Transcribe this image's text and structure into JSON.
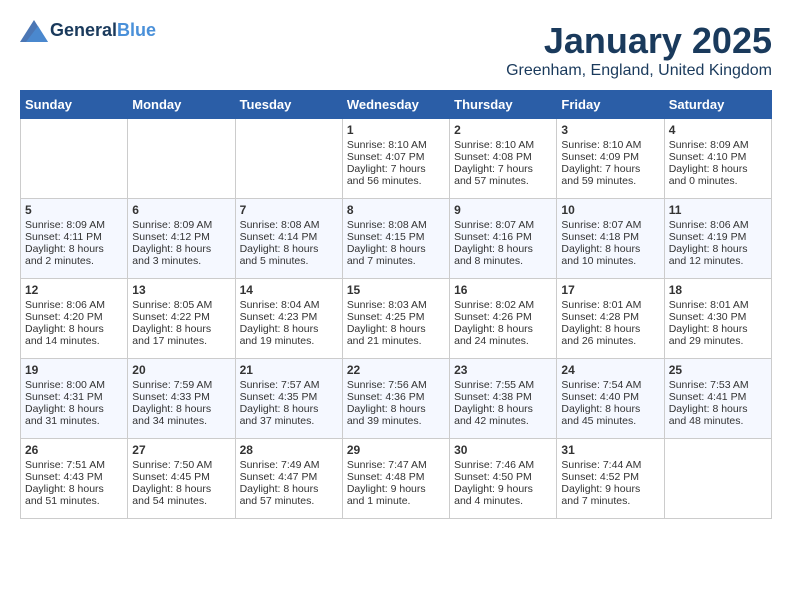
{
  "header": {
    "logo_line1": "General",
    "logo_line2": "Blue",
    "month_title": "January 2025",
    "location": "Greenham, England, United Kingdom"
  },
  "weekdays": [
    "Sunday",
    "Monday",
    "Tuesday",
    "Wednesday",
    "Thursday",
    "Friday",
    "Saturday"
  ],
  "weeks": [
    [
      {
        "num": "",
        "sunrise": "",
        "sunset": "",
        "daylight": ""
      },
      {
        "num": "",
        "sunrise": "",
        "sunset": "",
        "daylight": ""
      },
      {
        "num": "",
        "sunrise": "",
        "sunset": "",
        "daylight": ""
      },
      {
        "num": "1",
        "sunrise": "Sunrise: 8:10 AM",
        "sunset": "Sunset: 4:07 PM",
        "daylight": "Daylight: 7 hours and 56 minutes."
      },
      {
        "num": "2",
        "sunrise": "Sunrise: 8:10 AM",
        "sunset": "Sunset: 4:08 PM",
        "daylight": "Daylight: 7 hours and 57 minutes."
      },
      {
        "num": "3",
        "sunrise": "Sunrise: 8:10 AM",
        "sunset": "Sunset: 4:09 PM",
        "daylight": "Daylight: 7 hours and 59 minutes."
      },
      {
        "num": "4",
        "sunrise": "Sunrise: 8:09 AM",
        "sunset": "Sunset: 4:10 PM",
        "daylight": "Daylight: 8 hours and 0 minutes."
      }
    ],
    [
      {
        "num": "5",
        "sunrise": "Sunrise: 8:09 AM",
        "sunset": "Sunset: 4:11 PM",
        "daylight": "Daylight: 8 hours and 2 minutes."
      },
      {
        "num": "6",
        "sunrise": "Sunrise: 8:09 AM",
        "sunset": "Sunset: 4:12 PM",
        "daylight": "Daylight: 8 hours and 3 minutes."
      },
      {
        "num": "7",
        "sunrise": "Sunrise: 8:08 AM",
        "sunset": "Sunset: 4:14 PM",
        "daylight": "Daylight: 8 hours and 5 minutes."
      },
      {
        "num": "8",
        "sunrise": "Sunrise: 8:08 AM",
        "sunset": "Sunset: 4:15 PM",
        "daylight": "Daylight: 8 hours and 7 minutes."
      },
      {
        "num": "9",
        "sunrise": "Sunrise: 8:07 AM",
        "sunset": "Sunset: 4:16 PM",
        "daylight": "Daylight: 8 hours and 8 minutes."
      },
      {
        "num": "10",
        "sunrise": "Sunrise: 8:07 AM",
        "sunset": "Sunset: 4:18 PM",
        "daylight": "Daylight: 8 hours and 10 minutes."
      },
      {
        "num": "11",
        "sunrise": "Sunrise: 8:06 AM",
        "sunset": "Sunset: 4:19 PM",
        "daylight": "Daylight: 8 hours and 12 minutes."
      }
    ],
    [
      {
        "num": "12",
        "sunrise": "Sunrise: 8:06 AM",
        "sunset": "Sunset: 4:20 PM",
        "daylight": "Daylight: 8 hours and 14 minutes."
      },
      {
        "num": "13",
        "sunrise": "Sunrise: 8:05 AM",
        "sunset": "Sunset: 4:22 PM",
        "daylight": "Daylight: 8 hours and 17 minutes."
      },
      {
        "num": "14",
        "sunrise": "Sunrise: 8:04 AM",
        "sunset": "Sunset: 4:23 PM",
        "daylight": "Daylight: 8 hours and 19 minutes."
      },
      {
        "num": "15",
        "sunrise": "Sunrise: 8:03 AM",
        "sunset": "Sunset: 4:25 PM",
        "daylight": "Daylight: 8 hours and 21 minutes."
      },
      {
        "num": "16",
        "sunrise": "Sunrise: 8:02 AM",
        "sunset": "Sunset: 4:26 PM",
        "daylight": "Daylight: 8 hours and 24 minutes."
      },
      {
        "num": "17",
        "sunrise": "Sunrise: 8:01 AM",
        "sunset": "Sunset: 4:28 PM",
        "daylight": "Daylight: 8 hours and 26 minutes."
      },
      {
        "num": "18",
        "sunrise": "Sunrise: 8:01 AM",
        "sunset": "Sunset: 4:30 PM",
        "daylight": "Daylight: 8 hours and 29 minutes."
      }
    ],
    [
      {
        "num": "19",
        "sunrise": "Sunrise: 8:00 AM",
        "sunset": "Sunset: 4:31 PM",
        "daylight": "Daylight: 8 hours and 31 minutes."
      },
      {
        "num": "20",
        "sunrise": "Sunrise: 7:59 AM",
        "sunset": "Sunset: 4:33 PM",
        "daylight": "Daylight: 8 hours and 34 minutes."
      },
      {
        "num": "21",
        "sunrise": "Sunrise: 7:57 AM",
        "sunset": "Sunset: 4:35 PM",
        "daylight": "Daylight: 8 hours and 37 minutes."
      },
      {
        "num": "22",
        "sunrise": "Sunrise: 7:56 AM",
        "sunset": "Sunset: 4:36 PM",
        "daylight": "Daylight: 8 hours and 39 minutes."
      },
      {
        "num": "23",
        "sunrise": "Sunrise: 7:55 AM",
        "sunset": "Sunset: 4:38 PM",
        "daylight": "Daylight: 8 hours and 42 minutes."
      },
      {
        "num": "24",
        "sunrise": "Sunrise: 7:54 AM",
        "sunset": "Sunset: 4:40 PM",
        "daylight": "Daylight: 8 hours and 45 minutes."
      },
      {
        "num": "25",
        "sunrise": "Sunrise: 7:53 AM",
        "sunset": "Sunset: 4:41 PM",
        "daylight": "Daylight: 8 hours and 48 minutes."
      }
    ],
    [
      {
        "num": "26",
        "sunrise": "Sunrise: 7:51 AM",
        "sunset": "Sunset: 4:43 PM",
        "daylight": "Daylight: 8 hours and 51 minutes."
      },
      {
        "num": "27",
        "sunrise": "Sunrise: 7:50 AM",
        "sunset": "Sunset: 4:45 PM",
        "daylight": "Daylight: 8 hours and 54 minutes."
      },
      {
        "num": "28",
        "sunrise": "Sunrise: 7:49 AM",
        "sunset": "Sunset: 4:47 PM",
        "daylight": "Daylight: 8 hours and 57 minutes."
      },
      {
        "num": "29",
        "sunrise": "Sunrise: 7:47 AM",
        "sunset": "Sunset: 4:48 PM",
        "daylight": "Daylight: 9 hours and 1 minute."
      },
      {
        "num": "30",
        "sunrise": "Sunrise: 7:46 AM",
        "sunset": "Sunset: 4:50 PM",
        "daylight": "Daylight: 9 hours and 4 minutes."
      },
      {
        "num": "31",
        "sunrise": "Sunrise: 7:44 AM",
        "sunset": "Sunset: 4:52 PM",
        "daylight": "Daylight: 9 hours and 7 minutes."
      },
      {
        "num": "",
        "sunrise": "",
        "sunset": "",
        "daylight": ""
      }
    ]
  ]
}
